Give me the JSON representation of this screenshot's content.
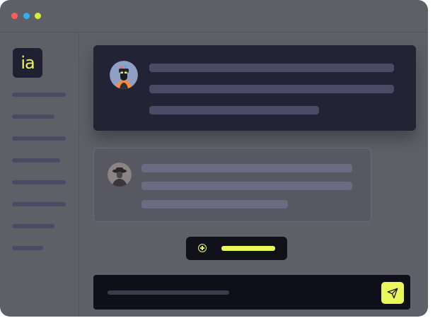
{
  "colors": {
    "window_bg": "#5f5f68",
    "dot_red": "#ff5f57",
    "dot_blue": "#33aff0",
    "dot_yellow": "#d7ec3a",
    "logo_bg": "#1f2031",
    "logo_text": "#e9f75a",
    "skeleton": "#4a4b63",
    "card_primary_bg": "#222335",
    "card_primary_line": "#4a4b66",
    "card_secondary_bg": "#585863",
    "card_secondary_line": "#6b6c81",
    "button_bg": "#0f1018",
    "accent": "#e9f75a",
    "composer_bg": "#0f0f19"
  },
  "sidebar": {
    "logo_text": "ia",
    "item_count": 8
  },
  "icons": {
    "window_controls": [
      "close-dot",
      "minimize-dot",
      "maximize-dot"
    ],
    "avatar_primary": "user-avatar-icon",
    "avatar_secondary": "user-avatar-icon",
    "add": "plus-circle-icon",
    "send": "paper-plane-icon"
  }
}
